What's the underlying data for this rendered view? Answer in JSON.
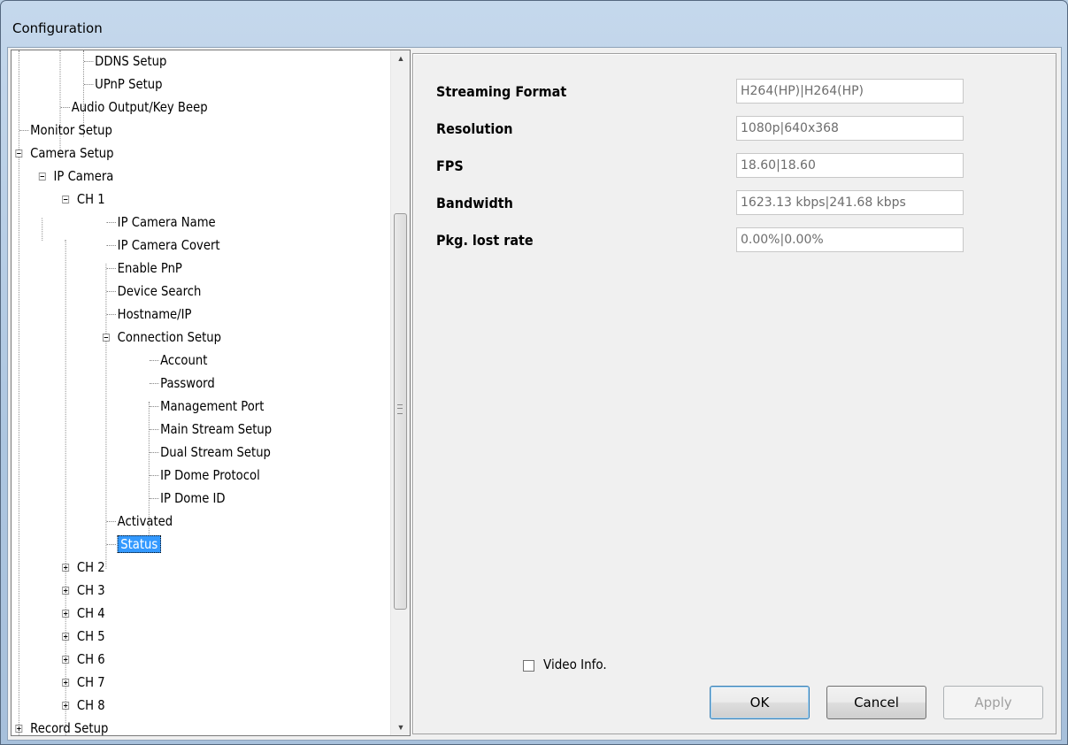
{
  "window": {
    "title": "Configuration"
  },
  "tree": {
    "items": [
      {
        "label": "DDNS Setup"
      },
      {
        "label": "UPnP Setup"
      },
      {
        "label": "Audio Output/Key Beep"
      },
      {
        "label": "Monitor Setup"
      },
      {
        "label": "Camera Setup"
      },
      {
        "label": "IP Camera"
      },
      {
        "label": "CH 1"
      },
      {
        "label": "IP Camera Name"
      },
      {
        "label": "IP Camera Covert"
      },
      {
        "label": "Enable PnP"
      },
      {
        "label": "Device Search"
      },
      {
        "label": "Hostname/IP"
      },
      {
        "label": "Connection Setup"
      },
      {
        "label": "Account"
      },
      {
        "label": "Password"
      },
      {
        "label": "Management Port"
      },
      {
        "label": "Main Stream Setup"
      },
      {
        "label": "Dual Stream Setup"
      },
      {
        "label": "IP Dome Protocol"
      },
      {
        "label": "IP Dome ID"
      },
      {
        "label": "Activated"
      },
      {
        "label": "Status"
      },
      {
        "label": "CH 2"
      },
      {
        "label": "CH 3"
      },
      {
        "label": "CH 4"
      },
      {
        "label": "CH 5"
      },
      {
        "label": "CH 6"
      },
      {
        "label": "CH 7"
      },
      {
        "label": "CH 8"
      },
      {
        "label": "Record Setup"
      }
    ]
  },
  "status": {
    "fields": [
      {
        "label": "Streaming Format",
        "value": "H264(HP)|H264(HP)"
      },
      {
        "label": "Resolution",
        "value": "1080p|640x368"
      },
      {
        "label": "FPS",
        "value": "18.60|18.60"
      },
      {
        "label": "Bandwidth",
        "value": "1623.13 kbps|241.68 kbps"
      },
      {
        "label": "Pkg. lost rate",
        "value": "0.00%|0.00%"
      }
    ],
    "video_info_label": "Video Info.",
    "video_info_checked": false
  },
  "buttons": {
    "ok": "OK",
    "cancel": "Cancel",
    "apply": "Apply"
  },
  "icons": {
    "scroll_up": "scroll-up-arrow-icon",
    "scroll_down": "scroll-down-arrow-icon",
    "expand": "tree-expand-icon",
    "collapse": "tree-collapse-icon"
  },
  "colors": {
    "selection": "#3399ff",
    "titlebar": "#b9d1ea"
  }
}
